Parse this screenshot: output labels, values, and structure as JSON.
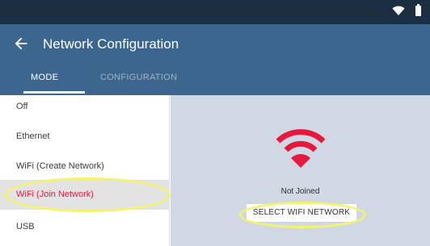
{
  "status_bar": {
    "icons": [
      "wifi-icon",
      "battery-icon"
    ]
  },
  "header": {
    "title": "Network Configuration",
    "back_icon": "arrow-left-icon"
  },
  "tabs": [
    {
      "label": "MODE",
      "active": true
    },
    {
      "label": "CONFIGURATION",
      "active": false
    }
  ],
  "sidebar": {
    "items": [
      {
        "label": "Off",
        "selected": false
      },
      {
        "label": "Ethernet",
        "selected": false
      },
      {
        "label": "WiFi (Create Network)",
        "selected": false
      },
      {
        "label": "WiFi (Join Network)",
        "selected": true
      },
      {
        "label": "USB",
        "selected": false
      }
    ]
  },
  "main": {
    "status_icon": "wifi-signal-icon",
    "status": "Not Joined",
    "button_label": "SELECT WIFI NETWORK"
  },
  "colors": {
    "status_bar": "#1b2e42",
    "app_bar": "#3d668f",
    "accent": "#e8183c",
    "content_bg": "#cfd8e3",
    "highlight": "#f5f36a"
  }
}
